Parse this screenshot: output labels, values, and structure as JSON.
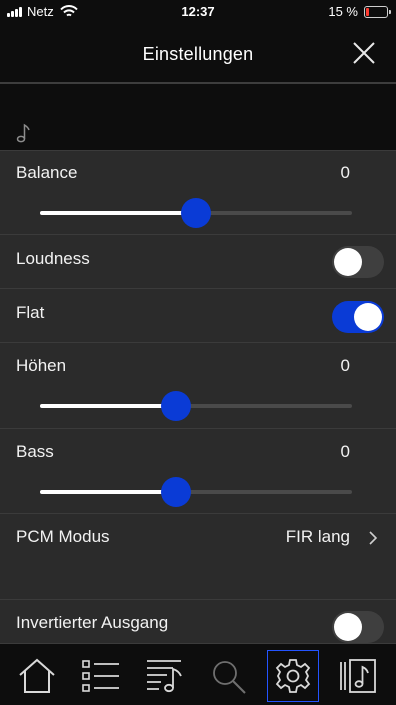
{
  "status_bar": {
    "carrier": "Netz",
    "time": "12:37",
    "battery_percent": "15 %",
    "battery_level": 0.15
  },
  "nav": {
    "title": "Einstellungen",
    "close_icon": "close-icon"
  },
  "header": {
    "icon": "music-note-icon"
  },
  "settings": {
    "balance": {
      "label": "Balance",
      "value": "0",
      "slider_fraction": 0.5
    },
    "loudness": {
      "label": "Loudness",
      "on": false
    },
    "flat": {
      "label": "Flat",
      "on": true
    },
    "treble": {
      "label": "Höhen",
      "value": "0",
      "slider_fraction": 0.435
    },
    "bass": {
      "label": "Bass",
      "value": "0",
      "slider_fraction": 0.435
    },
    "pcm_mode": {
      "label": "PCM Modus",
      "value": "FIR lang"
    },
    "inverted_output": {
      "label": "Invertierter Ausgang",
      "on": false
    }
  },
  "colors": {
    "accent": "#0a3bd6",
    "background": "#2b2b2b",
    "bar_background": "#0d0d0d",
    "active_tab_border": "#2454ff"
  },
  "tabbar": {
    "items": [
      {
        "icon": "home-icon",
        "active": false
      },
      {
        "icon": "list-icon",
        "active": false
      },
      {
        "icon": "playlist-icon",
        "active": false
      },
      {
        "icon": "search-icon",
        "active": false
      },
      {
        "icon": "gear-icon",
        "active": true
      },
      {
        "icon": "music-library-icon",
        "active": false
      }
    ]
  }
}
